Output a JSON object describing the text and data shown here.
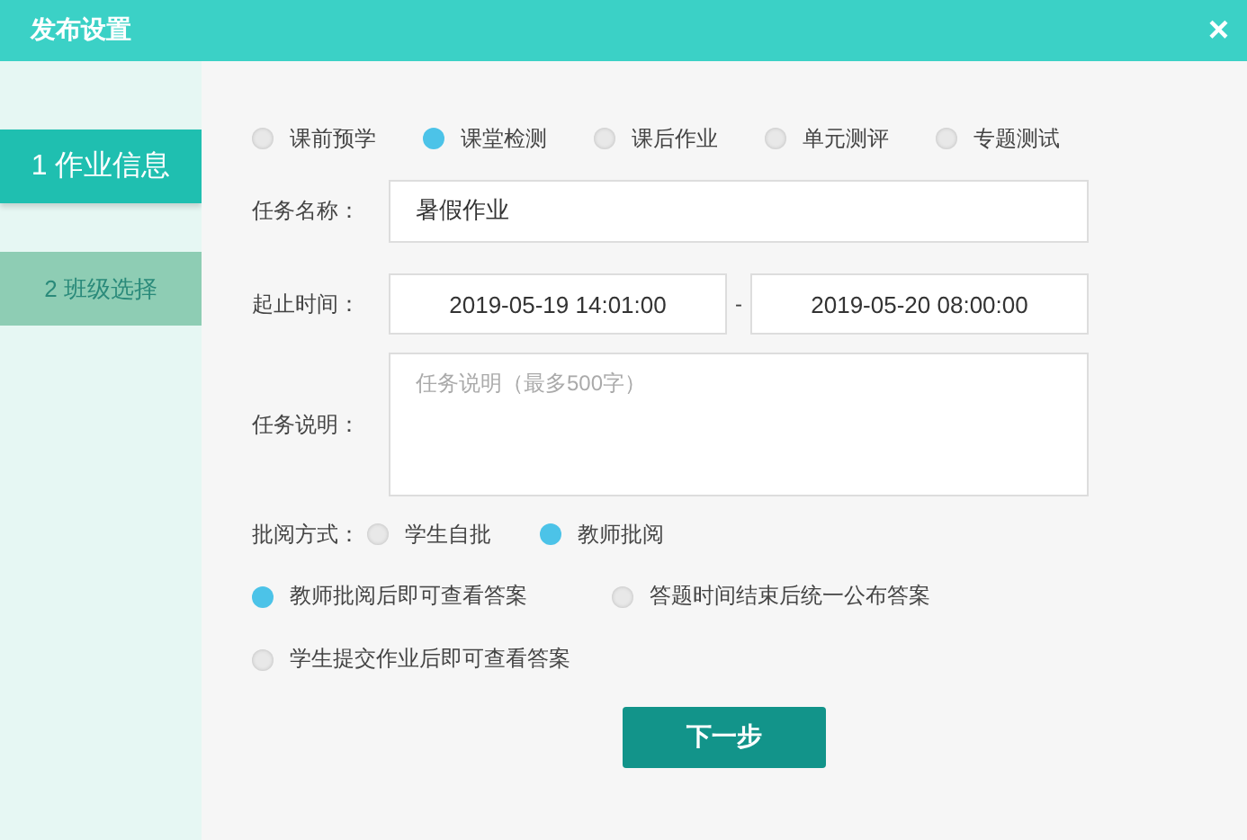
{
  "window": {
    "title": "发布设置",
    "close": "×"
  },
  "steps": [
    {
      "label": "1 作业信息",
      "selected": true
    },
    {
      "label": "2 班级选择",
      "selected": false
    }
  ],
  "task_types": [
    {
      "label": "课前预学",
      "selected": false
    },
    {
      "label": "课堂检测",
      "selected": true
    },
    {
      "label": "课后作业",
      "selected": false
    },
    {
      "label": "单元测评",
      "selected": false
    },
    {
      "label": "专题测试",
      "selected": false
    }
  ],
  "task_name": {
    "label": "任务名称：",
    "value": "暑假作业"
  },
  "time_range": {
    "label": "起止时间：",
    "start": "2019-05-19 14:01:00",
    "separator": "-",
    "end": "2019-05-20 08:00:00"
  },
  "description": {
    "label": "任务说明：",
    "placeholder": "任务说明（最多500字）"
  },
  "review_mode": {
    "label": "批阅方式：",
    "options": [
      {
        "label": "学生自批",
        "selected": false
      },
      {
        "label": "教师批阅",
        "selected": true
      }
    ]
  },
  "answer_options": [
    {
      "label": "教师批阅后即可查看答案",
      "selected": true
    },
    {
      "label": "答题时间结束后统一公布答案",
      "selected": false
    },
    {
      "label": "学生提交作业后即可查看答案",
      "selected": false
    }
  ],
  "next_button": "下一步"
}
